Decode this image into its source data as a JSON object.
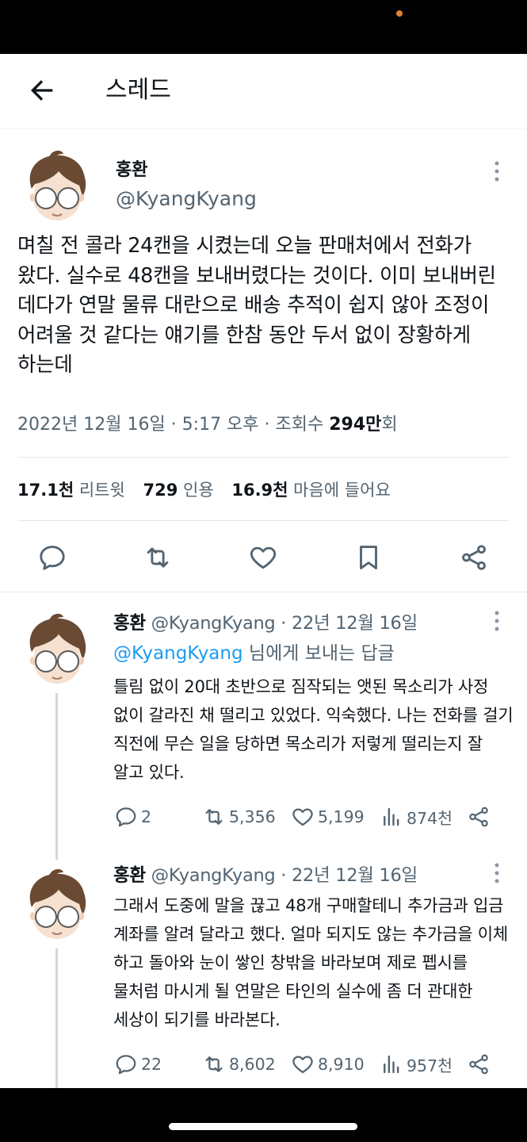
{
  "header": {
    "title": "스레드"
  },
  "tweet": {
    "name": "홍환",
    "handle": "@KyangKyang",
    "text": "며칠 전 콜라 24캔을 시켰는데 오늘 판매처에서 전화가 왔다. 실수로 48캔을 보내버렸다는 것이다. 이미 보내버린 데다가 연말 물류 대란으로 배송 추적이 쉽지 않아 조정이 어려울 것 같다는 얘기를 한참 동안 두서 없이 장황하게 하는데",
    "meta_date": "2022년 12월 16일 · 5:17 오후 · 조회수 ",
    "views_bold": "294만",
    "views_suffix": "회",
    "stats": {
      "retweets_num": "17.1천",
      "retweets_label": "리트윗",
      "quotes_num": "729",
      "quotes_label": "인용",
      "likes_num": "16.9천",
      "likes_label": "마음에 들어요"
    }
  },
  "replies": [
    {
      "name": "홍환",
      "meta": "@KyangKyang · 22년 12월 16일",
      "reply_to_mention": "@KyangKyang",
      "reply_to_suffix": " 님에게 보내는 답글",
      "text": "틀림 없이 20대 초반으로 짐작되는 앳된 목소리가 사정 없이 갈라진 채 떨리고 있었다. 익숙했다. 나는 전화를 걸기 직전에 무슨 일을 당하면 목소리가 저렇게 떨리는지 잘 알고 있다.",
      "replies": "2",
      "retweets": "5,356",
      "likes": "5,199",
      "views": "874천"
    },
    {
      "name": "홍환",
      "meta": "@KyangKyang · 22년 12월 16일",
      "text": "그래서 도중에 말을 끊고 48개 구매할테니 추가금과 입금 계좌를 알려 달라고 했다. 얼마 되지도 않는 추가금을 이체 하고 돌아와 눈이 쌓인 창밖을 바라보며 제로 펩시를 물처럼 마시게 될 연말은 타인의 실수에 좀 더 관대한 세상이 되기를 바라본다.",
      "replies": "22",
      "retweets": "8,602",
      "likes": "8,910",
      "views": "957천"
    }
  ]
}
